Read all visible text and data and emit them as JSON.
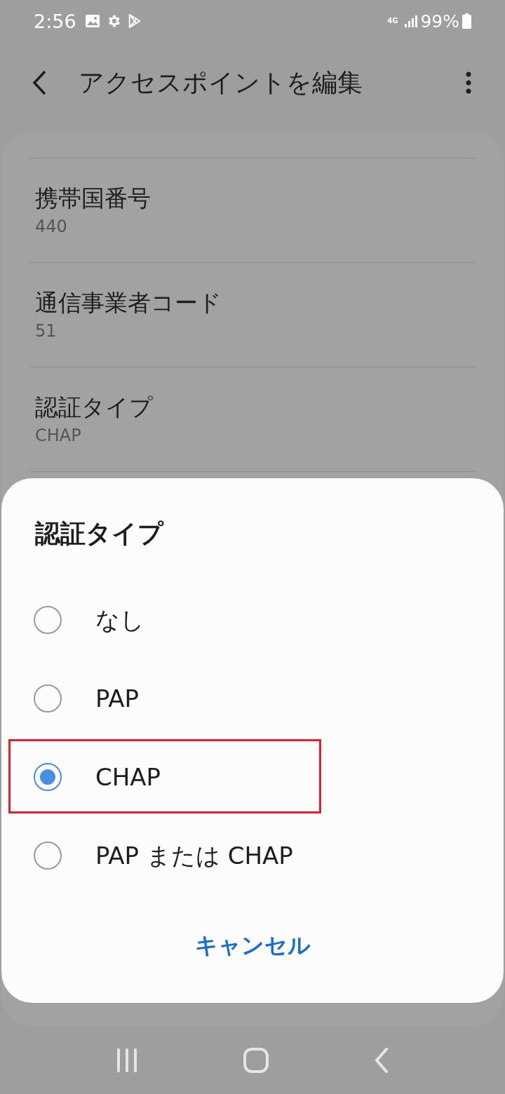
{
  "status_bar": {
    "time": "2:56",
    "network_type": "4G",
    "battery": "99%"
  },
  "header": {
    "title": "アクセスポイントを編集"
  },
  "settings": [
    {
      "title": "携帯国番号",
      "value": "440"
    },
    {
      "title": "通信事業者コード",
      "value": "51"
    },
    {
      "title": "認証タイプ",
      "value": "CHAP"
    }
  ],
  "dialog": {
    "title": "認証タイプ",
    "options": [
      {
        "label": "なし",
        "selected": false
      },
      {
        "label": "PAP",
        "selected": false
      },
      {
        "label": "CHAP",
        "selected": true
      },
      {
        "label": "PAP または CHAP",
        "selected": false
      }
    ],
    "cancel": "キャンセル"
  }
}
